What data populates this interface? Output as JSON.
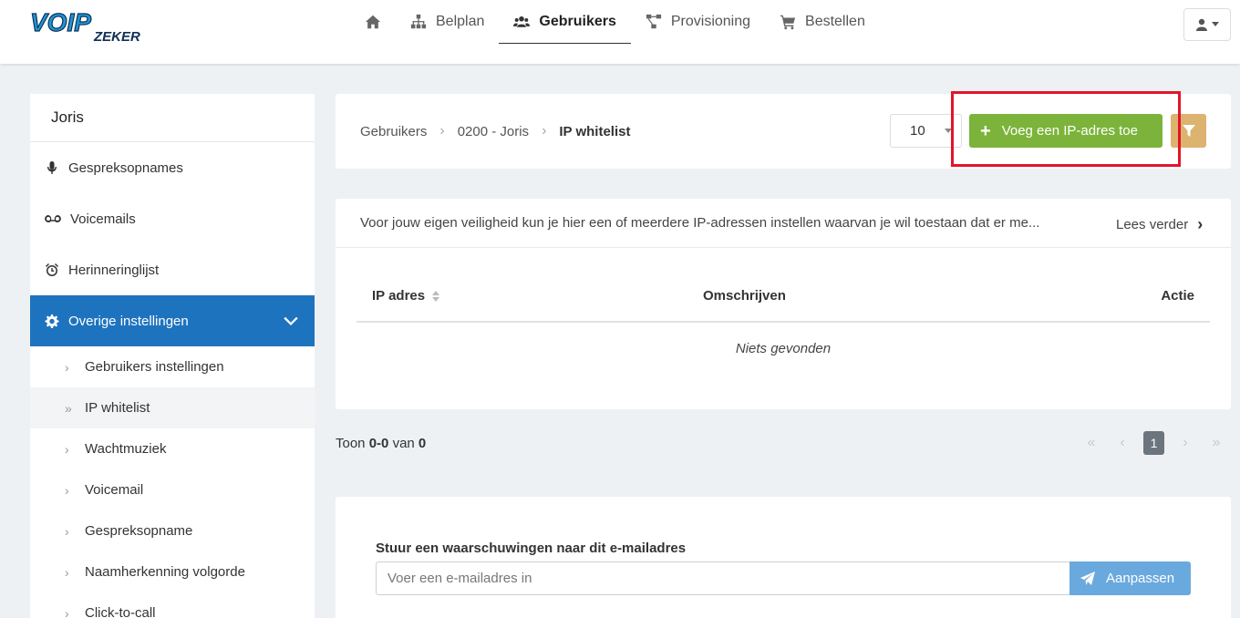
{
  "brand": {
    "logo_text": "VOIPZEKER"
  },
  "nav": {
    "items": [
      {
        "label": "",
        "icon": "home-icon"
      },
      {
        "label": "Belplan",
        "icon": "sitemap-icon"
      },
      {
        "label": "Gebruikers",
        "icon": "users-icon",
        "active": true
      },
      {
        "label": "Provisioning",
        "icon": "network-icon"
      },
      {
        "label": "Bestellen",
        "icon": "cart-icon"
      }
    ],
    "user_menu_icon": "user-icon"
  },
  "sidebar": {
    "title": "Joris",
    "items": [
      {
        "label": "Gespreksopnames",
        "icon": "microphone-icon"
      },
      {
        "label": "Voicemails",
        "icon": "voicemail-icon"
      },
      {
        "label": "Herinneringlijst",
        "icon": "alarm-clock-icon"
      },
      {
        "label": "Overige instellingen",
        "icon": "gear-icon",
        "active": true
      }
    ],
    "sub_items": [
      {
        "label": "Gebruikers instellingen"
      },
      {
        "label": "IP whitelist",
        "current": true
      },
      {
        "label": "Wachtmuziek"
      },
      {
        "label": "Voicemail"
      },
      {
        "label": "Gespreksopname"
      },
      {
        "label": "Naamherkenning volgorde"
      },
      {
        "label": "Click-to-call"
      }
    ]
  },
  "breadcrumb": {
    "items": [
      "Gebruikers",
      "0200 - Joris",
      "IP whitelist"
    ]
  },
  "toolbar": {
    "page_size": "10",
    "add_label": "Voeg een IP-adres toe",
    "filter_icon": "filter-icon"
  },
  "info": {
    "text": "Voor jouw eigen veiligheid kun je hier een of meerdere IP-adressen instellen waarvan je wil toestaan dat er me...",
    "more_label": "Lees verder"
  },
  "table": {
    "columns": [
      "IP adres",
      "Omschrijven",
      "Actie"
    ],
    "empty_text": "Niets gevonden"
  },
  "pagination": {
    "prefix": "Toon",
    "range": "0-0",
    "of": "van",
    "total": "0",
    "current_page": "1"
  },
  "email": {
    "label": "Stuur een waarschuwingen naar dit e-mailadres",
    "placeholder": "Voer een e-mailadres in",
    "button_label": "Aanpassen"
  },
  "colors": {
    "primary": "#1e73be",
    "add_button": "#7cb33a",
    "filter_button": "#dcb36f",
    "mail_button": "#6aa9de",
    "highlight": "#e3142a"
  }
}
